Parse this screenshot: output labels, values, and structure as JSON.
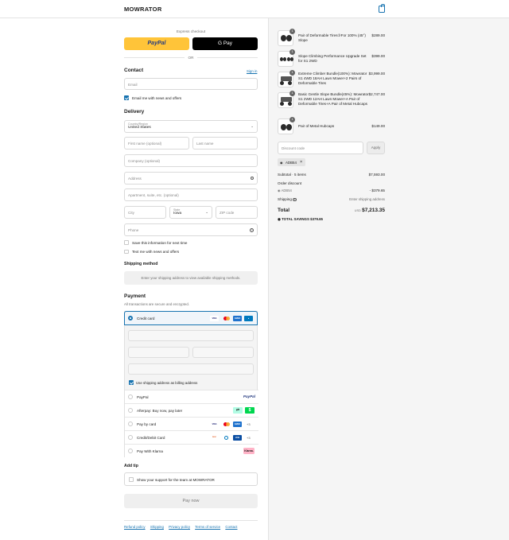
{
  "header": {
    "brand": "MOWRATOR",
    "cart_icon": "shopping-bag-icon"
  },
  "express": {
    "heading": "Express checkout",
    "paypal_label": "PayPal",
    "gpay_label": "G Pay",
    "or": "OR"
  },
  "contact": {
    "title": "Contact",
    "signin": "Sign in",
    "email_placeholder": "Email",
    "news_label": "Email me with news and offers"
  },
  "delivery": {
    "title": "Delivery",
    "country_label": "Country/Region",
    "country_value": "United States",
    "first_name": "First name (optional)",
    "last_name": "Last name",
    "company": "Company (optional)",
    "address": "Address",
    "apartment": "Apartment, suite, etc. (optional)",
    "city": "City",
    "state_label": "State",
    "state_value": "Iowa",
    "zip": "ZIP code",
    "phone": "Phone",
    "save_info": "Save this information for next time",
    "text_news": "Text me with news and offers"
  },
  "shipping_method": {
    "title": "Shipping method",
    "notice": "Enter your shipping address to view available shipping methods."
  },
  "payment": {
    "title": "Payment",
    "subtitle": "All transactions are secure and encrypted.",
    "credit_card": "Credit card",
    "use_shipping": "Use shipping address as billing address",
    "options": [
      "PayPal",
      "Afterpay: Buy now, pay later",
      "Pay by card",
      "Credit/Debit Card",
      "Pay With Klarna"
    ],
    "more_cards_1": "+3",
    "more_cards_2": "+3",
    "more_cards_3": "+3",
    "card_visa": "VISA",
    "card_amex": "AMEX",
    "paypal_mark": "PayPal",
    "klarna_mark": "Klarna."
  },
  "tip": {
    "title": "Add tip",
    "label": "Show your support for the team at MOWRATOR"
  },
  "pay_button": "Pay now",
  "footer_links": [
    "Refund policy",
    "Shipping",
    "Privacy policy",
    "Terms of service",
    "Contact"
  ],
  "order": {
    "items": [
      {
        "qty": "1",
        "title": "Pair of Deformable Tires③For 100% (45°) Slope",
        "price": "$289.00"
      },
      {
        "qty": "1",
        "title": "Slope Climbing Performance Upgrade Set for S1 2WD",
        "price": "$399.00"
      },
      {
        "qty": "1",
        "title": "Extreme Climber Bundle(100%): Mowrator S1 4WD 18AH Lawn Mower+2 Pairs of Deformable Tires",
        "price": "$3,999.00"
      },
      {
        "qty": "1",
        "title": "Basic Gentle Slope Bundle(45%): Mowrator S1 2WD 12AH Lawn Mower+A Pair of Deformable Tires+A Pair of Metal Hubcaps",
        "price": "$2,747.00"
      },
      {
        "qty": "1",
        "title": "Pair of Metal Hubcaps",
        "price": "$149.00"
      }
    ],
    "discount_placeholder": "Discount code",
    "apply": "Apply",
    "code_tag": "ADB54",
    "subtotal_label": "Subtotal · 5 items",
    "subtotal_value": "$7,593.00",
    "order_discount": "Order discount",
    "discount_code": "ADB54",
    "discount_value": "- $379.65",
    "shipping_label": "Shipping",
    "shipping_value": "Enter shipping address",
    "total_label": "Total",
    "currency": "USD",
    "total_value": "$7,213.35",
    "savings_label": "TOTAL SAVINGS",
    "savings_value": "$379.65"
  },
  "colors": {
    "accent": "#1773b0",
    "paypal_yellow": "#ffc439",
    "panel_bg": "#f5f5f5"
  }
}
